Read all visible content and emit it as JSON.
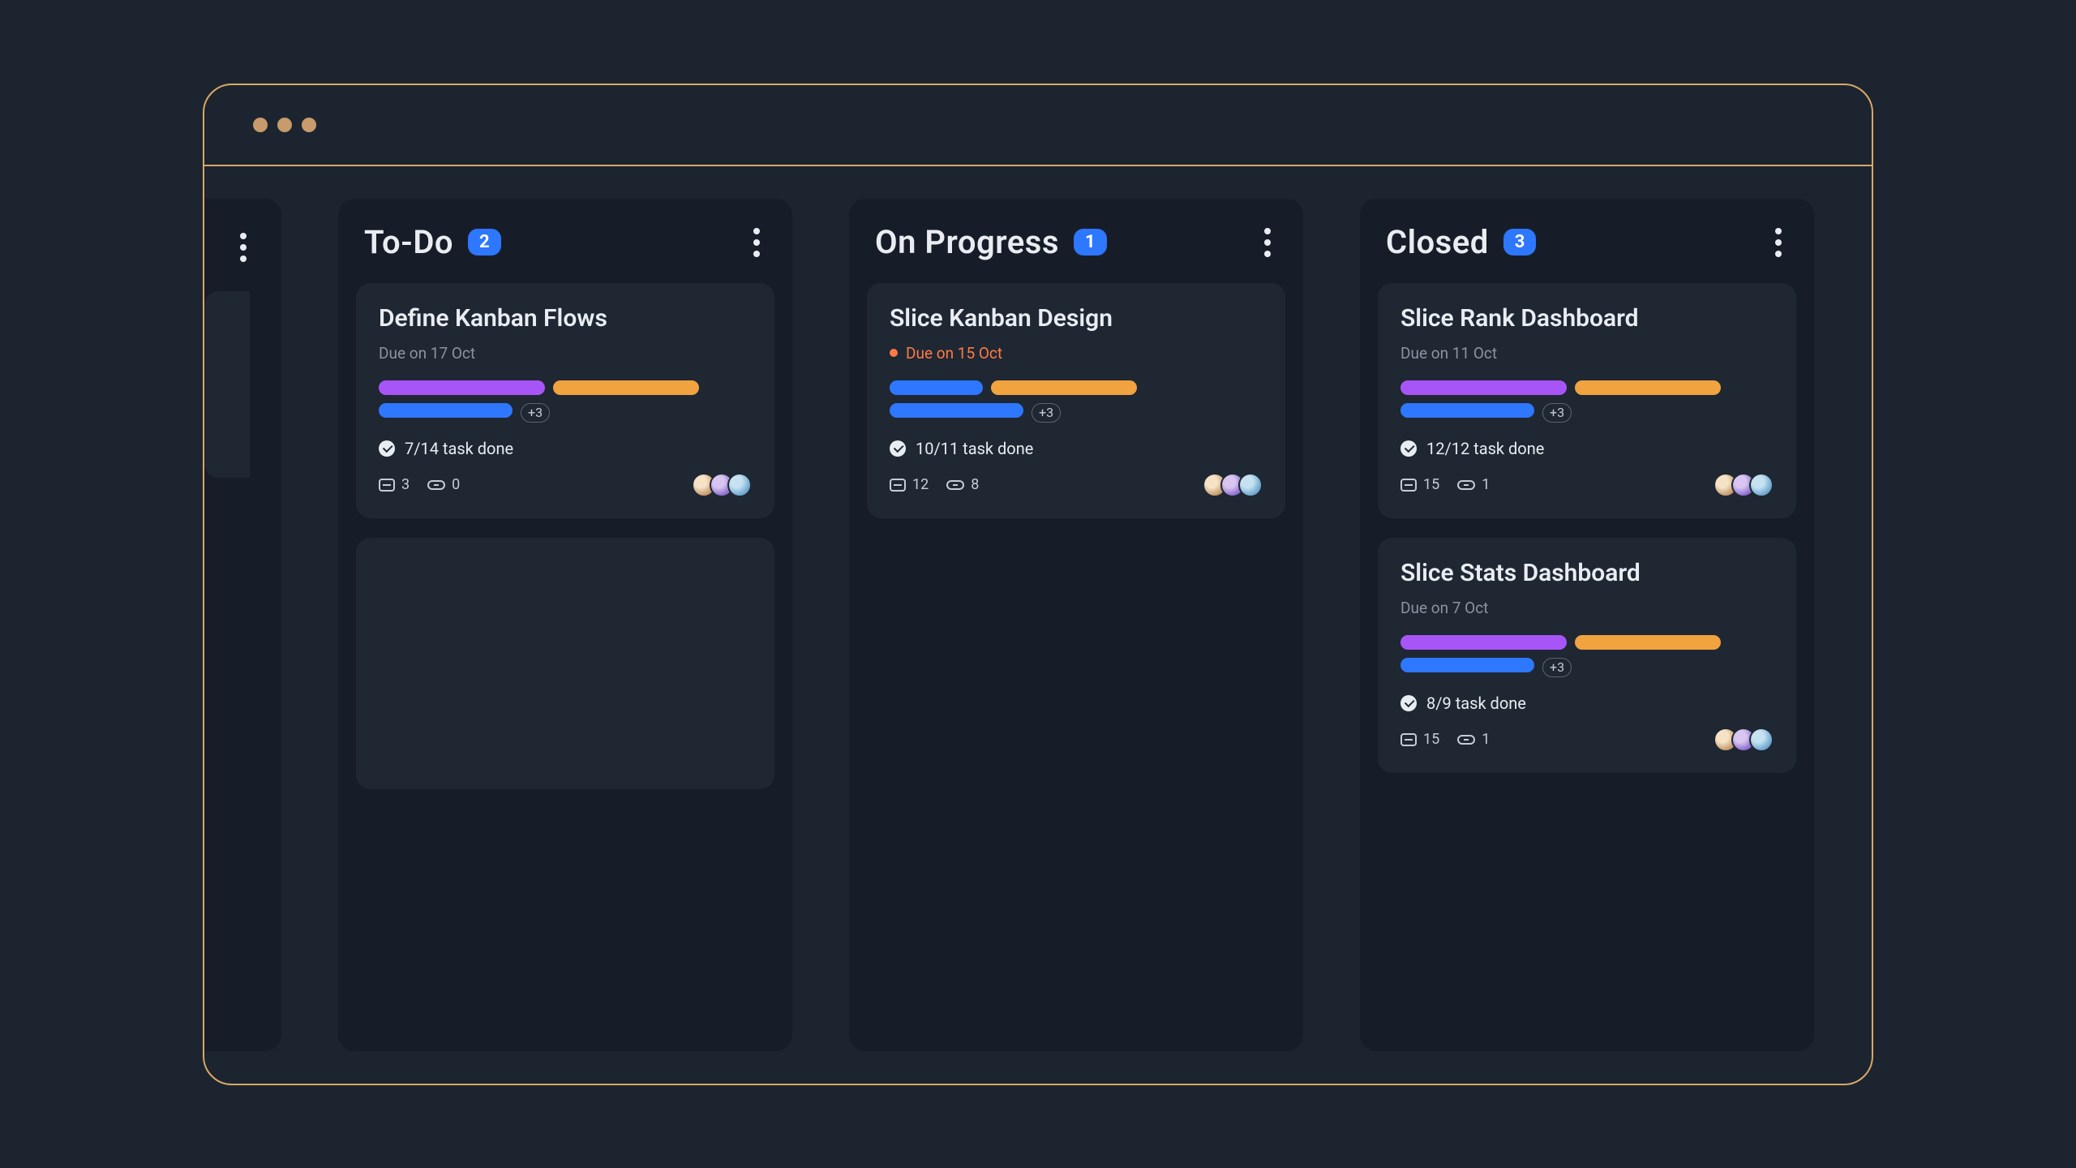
{
  "peek_column": {
    "card_visible": true
  },
  "columns": [
    {
      "title": "To-Do",
      "count": "2",
      "cards": [
        {
          "title": "Define Kanban Flows",
          "due": "Due on 17 Oct",
          "overdue": false,
          "tags": [
            "purple",
            "orange",
            "blue"
          ],
          "more_tags": "+3",
          "progress": "7/14 task done",
          "comments": "3",
          "attachments": "0",
          "avatars": 3
        }
      ],
      "empty_card": true
    },
    {
      "title": "On Progress",
      "count": "1",
      "cards": [
        {
          "title": "Slice Kanban Design",
          "due": "Due on 15 Oct",
          "overdue": true,
          "tags": [
            "blue-sm",
            "orange",
            "blue"
          ],
          "more_tags": "+3",
          "progress": "10/11 task done",
          "comments": "12",
          "attachments": "8",
          "avatars": 3
        }
      ],
      "empty_card": false
    },
    {
      "title": "Closed",
      "count": "3",
      "cards": [
        {
          "title": "Slice Rank Dashboard",
          "due": "Due on 11 Oct",
          "overdue": false,
          "tags": [
            "purple",
            "orange",
            "blue"
          ],
          "more_tags": "+3",
          "progress": "12/12 task done",
          "comments": "15",
          "attachments": "1",
          "avatars": 3
        },
        {
          "title": "Slice Stats Dashboard",
          "due": "Due on 7 Oct",
          "overdue": false,
          "tags": [
            "purple",
            "orange",
            "blue"
          ],
          "more_tags": "+3",
          "progress": "8/9 task done",
          "comments": "15",
          "attachments": "1",
          "avatars": 3
        }
      ],
      "empty_card": false
    }
  ]
}
